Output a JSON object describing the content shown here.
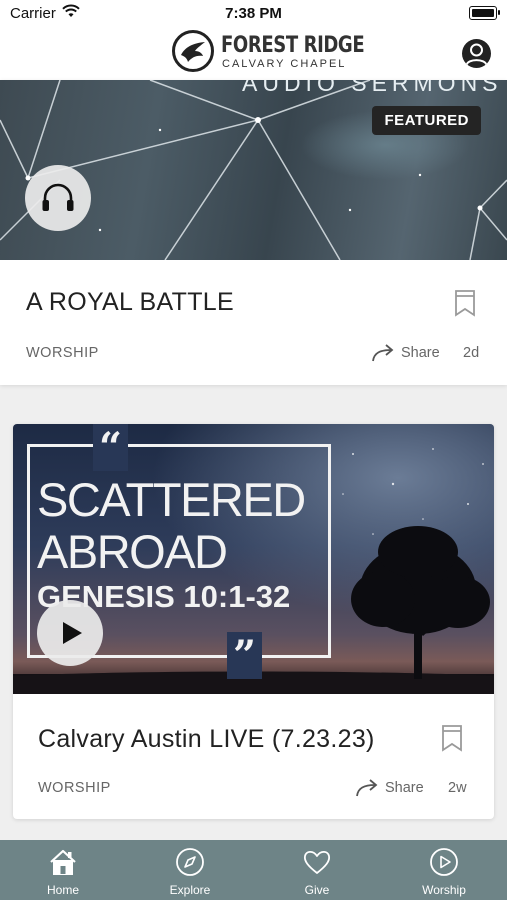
{
  "status_bar": {
    "carrier": "Carrier",
    "time": "7:38 PM"
  },
  "header": {
    "logo_title": "FOREST RIDGE",
    "logo_subtitle": "CALVARY CHAPEL",
    "icons": {
      "logo": "dove-logo-icon",
      "profile": "profile-icon"
    }
  },
  "feed": [
    {
      "image_heading": "AUDIO SERMONS",
      "badge": "FEATURED",
      "media_icon": "headphones-icon",
      "title": "A ROYAL BATTLE",
      "category": "WORSHIP",
      "share_label": "Share",
      "age": "2d"
    },
    {
      "image_text": {
        "line1": "SCATTERED",
        "line2": "ABROAD",
        "line3": "GENESIS 10:1-32",
        "open_quote": "“",
        "close_quote": "”"
      },
      "media_icon": "play-icon",
      "title": "Calvary Austin LIVE (7.23.23)",
      "category": "WORSHIP",
      "share_label": "Share",
      "age": "2w"
    }
  ],
  "tabs": [
    {
      "label": "Home",
      "icon": "home-icon",
      "active": true
    },
    {
      "label": "Explore",
      "icon": "compass-icon",
      "active": false
    },
    {
      "label": "Give",
      "icon": "heart-icon",
      "active": false
    },
    {
      "label": "Worship",
      "icon": "play-circle-icon",
      "active": false
    }
  ],
  "colors": {
    "tab_bar": "#6e8487",
    "badge_bg": "#242424",
    "text_primary": "#222222",
    "text_secondary": "#666666"
  }
}
